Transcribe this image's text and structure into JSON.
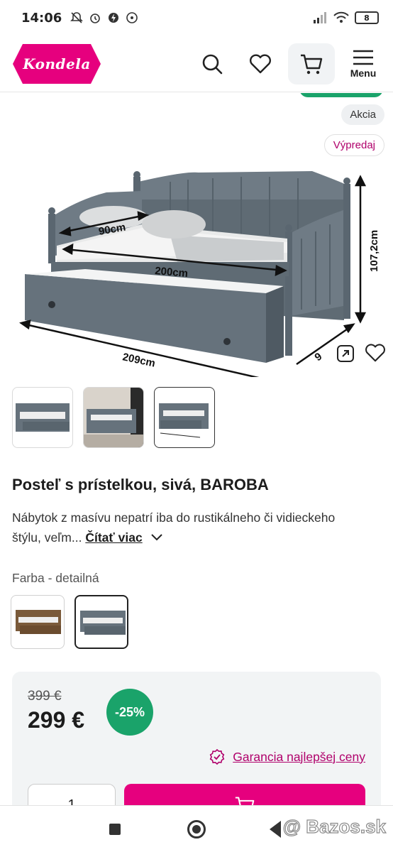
{
  "status_bar": {
    "time": "14:06",
    "battery": "8"
  },
  "header": {
    "logo_text": "Kondela",
    "menu_label": "Menu"
  },
  "badges": {
    "akcia": "Akcia",
    "vypredaj": "Výpredaj"
  },
  "image_labels": {
    "width": "90cm",
    "length": "200cm",
    "height": "107,2cm",
    "total_length": "209cm",
    "depth": "9"
  },
  "product": {
    "title": "Posteľ s prístelkou, sivá, BAROBA",
    "description": "Nábytok z masívu nepatrí iba do rustikálneho či vidieckeho štýlu, veľm...",
    "read_more": "Čítať viac"
  },
  "color": {
    "label": "Farba - detailná",
    "options": [
      "brown",
      "gray"
    ],
    "selected": "gray"
  },
  "price": {
    "old": "399 €",
    "new": "299 €",
    "discount": "-25%",
    "guarantee": "Garancia najlepšej ceny",
    "quantity": "1"
  },
  "watermark": "@ Bazos.sk",
  "colors": {
    "brand": "#e6007e",
    "discount": "#1aa36a",
    "link": "#b0006b"
  }
}
